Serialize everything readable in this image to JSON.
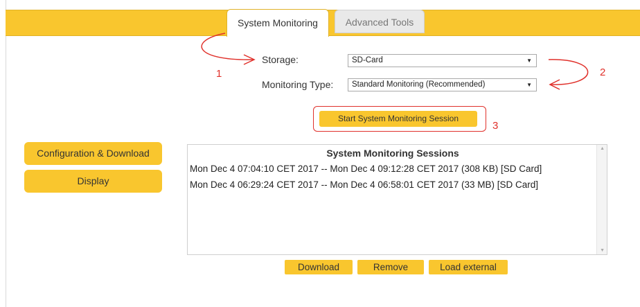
{
  "tabs": [
    {
      "label": "System Monitoring",
      "active": true
    },
    {
      "label": "Advanced Tools",
      "active": false
    }
  ],
  "form": {
    "storage_label": "Storage:",
    "storage_value": "SD-Card",
    "monitoring_type_label": "Monitoring Type:",
    "monitoring_type_value": "Standard Monitoring (Recommended)"
  },
  "start_button_label": "Start System Monitoring Session",
  "sidebar": {
    "items": [
      {
        "label": "Configuration & Download"
      },
      {
        "label": "Display"
      }
    ]
  },
  "sessions": {
    "title": "System Monitoring Sessions",
    "rows": [
      "Mon Dec 4 07:04:10 CET 2017 -- Mon Dec 4 09:12:28 CET 2017 (308 KB) [SD Card]",
      "Mon Dec 4 06:29:24 CET 2017 -- Mon Dec 4 06:58:01 CET 2017 (33 MB) [SD Card]"
    ]
  },
  "actions": {
    "download_label": "Download",
    "remove_label": "Remove",
    "load_external_label": "Load external"
  },
  "annotations": [
    "1",
    "2",
    "3"
  ],
  "colors": {
    "accent": "#f9c62e",
    "annotation": "#e0302a",
    "inactive_tab": "#e9e9e9"
  }
}
